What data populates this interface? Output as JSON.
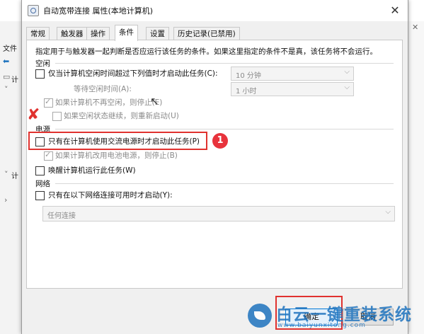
{
  "background_window": {
    "menu_file": "文件",
    "tree_label_1": "计",
    "tree_label_2": "计"
  },
  "dialog": {
    "title": "自动宽带连接 属性(本地计算机)",
    "close_glyph": "✕",
    "tabs": [
      {
        "label": "常规"
      },
      {
        "label": "触发器"
      },
      {
        "label": "操作"
      },
      {
        "label": "条件"
      },
      {
        "label": "设置"
      },
      {
        "label": "历史记录(已禁用)"
      }
    ],
    "active_tab": "条件",
    "description": "指定用于与触发器一起判断是否应运行该任务的条件。如果这里指定的条件不是真，该任务将不会运行。",
    "idle": {
      "group": "空闲",
      "start_if_idle_label": "仅当计算机空闲时间超过下列值时才启动此任务(C):",
      "start_if_idle_value": "10 分钟",
      "wait_idle_label": "等待空闲时间(A):",
      "wait_idle_value": "1 小时",
      "stop_if_not_idle_label": "如果计算机不再空闲，则停止(E)",
      "restart_if_idle_label": "如果空闲状态继续，则重新启动(U)"
    },
    "power": {
      "group": "电源",
      "ac_only_label": "只有在计算机使用交流电源时才启动此任务(P)",
      "stop_on_battery_label": "如果计算机改用电池电源，则停止(B)",
      "wake_label": "唤醒计算机运行此任务(W)"
    },
    "network": {
      "group": "网络",
      "network_only_label": "只有在以下网络连接可用时才启动(Y):",
      "network_value": "任何连接"
    },
    "ok_label": "确定",
    "cancel_label": "取消"
  },
  "annotations": {
    "step_badge": "1",
    "x_mark": "✘"
  },
  "watermark": {
    "text": "白云一键重装系统",
    "url": "www.baiyunxitong.com"
  }
}
